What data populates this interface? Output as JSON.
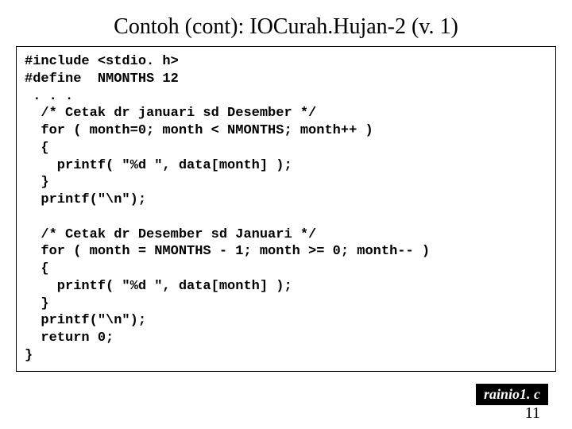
{
  "title": "Contoh (cont): IOCurah.Hujan-2 (v. 1)",
  "code": "#include <stdio. h>\n#define  NMONTHS 12\n . . .\n  /* Cetak dr januari sd Desember */\n  for ( month=0; month < NMONTHS; month++ )\n  {\n    printf( \"%d \", data[month] );\n  }\n  printf(\"\\n\");\n\n  /* Cetak dr Desember sd Januari */\n  for ( month = NMONTHS - 1; month >= 0; month-- )\n  {\n    printf( \"%d \", data[month] );\n  }\n  printf(\"\\n\");\n  return 0;\n}",
  "filename": "rainio1. c",
  "page": "11"
}
